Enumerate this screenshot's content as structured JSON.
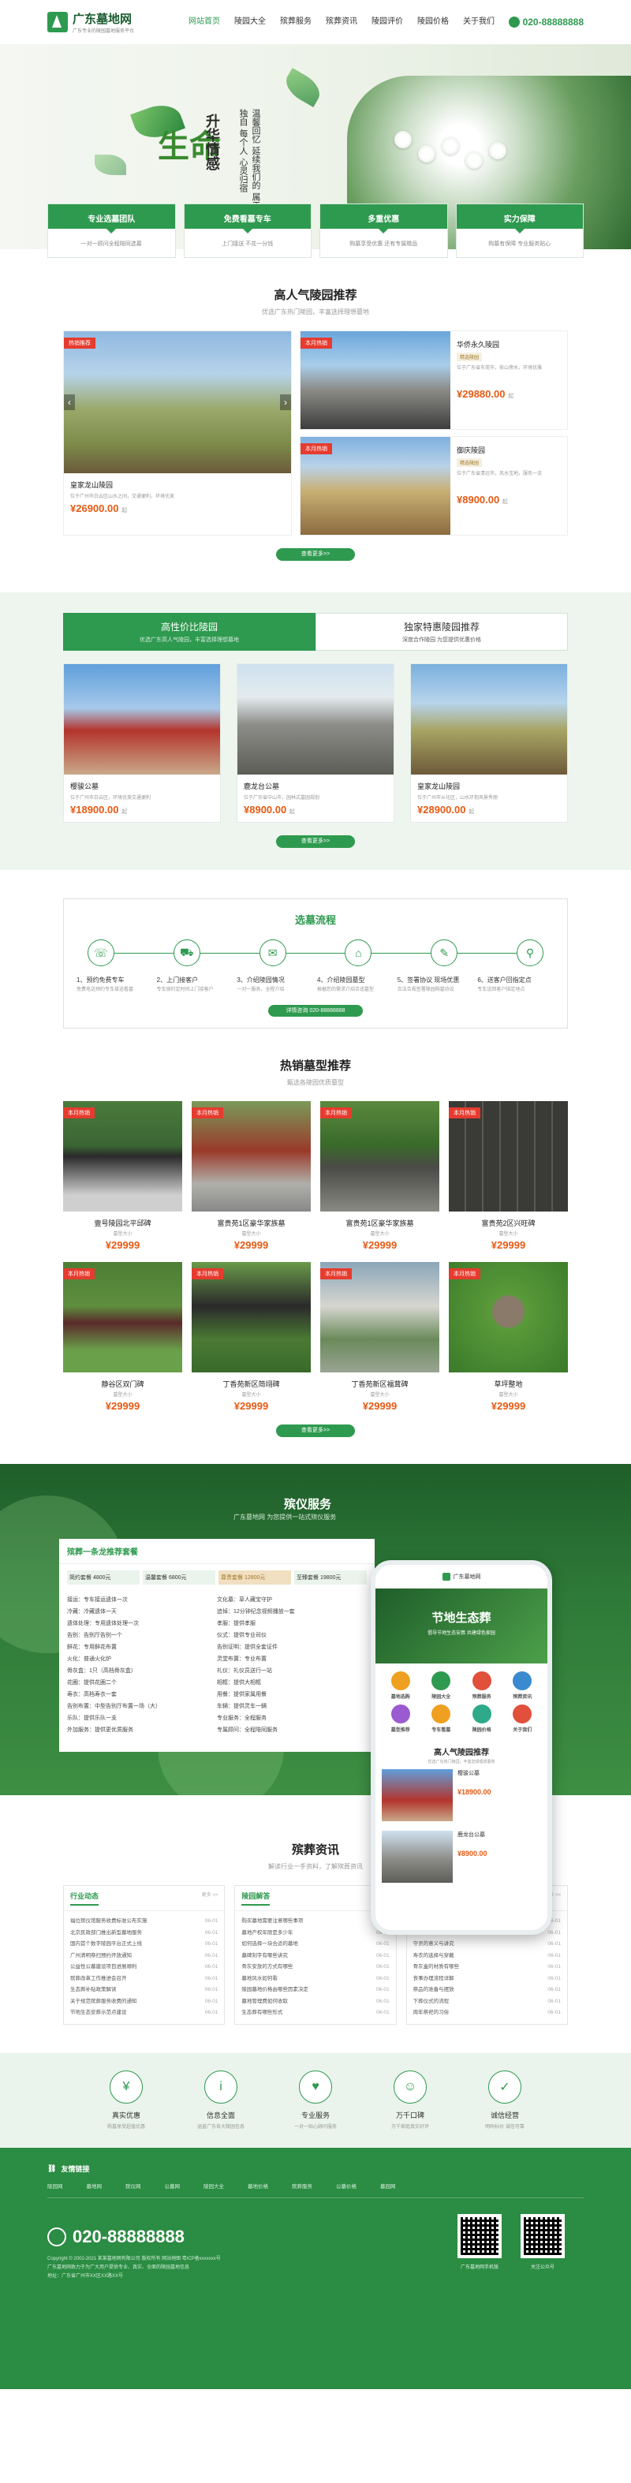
{
  "header": {
    "brand": "广东墓地网",
    "brand_sub": "广东专业的陵园墓地服务平台",
    "nav": [
      "网站首页",
      "陵园大全",
      "殡葬服务",
      "殡葬资讯",
      "陵园评价",
      "陵园价格",
      "关于我们"
    ],
    "phone": "020-88888888"
  },
  "banner": {
    "big_title": "生命",
    "vertical_1": "升华情感",
    "vertical_2": "温馨回忆 延续我们的 属于 独自 每个人 心灵归宿"
  },
  "features": [
    {
      "title": "专业选墓团队",
      "desc": "一对一顾问全程陪同选墓"
    },
    {
      "title": "免费看墓专车",
      "desc": "上门接送 不花一分钱"
    },
    {
      "title": "多重优惠",
      "desc": "购墓享受优惠 还有专属赠品"
    },
    {
      "title": "实力保障",
      "desc": "购墓有保障 专业服务贴心"
    }
  ],
  "popular": {
    "title": "高人气陵园推荐",
    "subtitle": "优选广东热门陵园，丰富选择理想墓地",
    "main": {
      "tag": "热销推荐",
      "name": "皇家龙山陵园",
      "desc": "位于广州市白云区山水之间，交通便利，环境优美",
      "price": "¥26900.00",
      "unit": "起"
    },
    "side": [
      {
        "tag": "本月热销",
        "name": "华侨永久陵园",
        "badge": "精选陵园",
        "desc": "位于广东省东莞市，依山傍水，环境优雅",
        "price": "¥29880.00",
        "unit": "起"
      },
      {
        "tag": "本月热销",
        "name": "御庆陵园",
        "badge": "精选陵园",
        "desc": "位于广东省清远市，风水宝地，服务一流",
        "price": "¥8900.00",
        "unit": "起"
      }
    ],
    "more": "查看更多>>"
  },
  "value": {
    "tabs": [
      {
        "title": "高性价比陵园",
        "sub": "优选广东高人气陵园，丰富选择理想墓地"
      },
      {
        "title": "独家特惠陵园推荐",
        "sub": "深度合作陵园 为您提供优惠价格"
      }
    ],
    "cards": [
      {
        "name": "樱骏公墓",
        "desc": "位于广州市白云区，环境优美交通便利",
        "price": "¥18900.00",
        "unit": "起"
      },
      {
        "name": "鹿龙台公墓",
        "desc": "位于广东省中山市，园林式墓园规划",
        "price": "¥8900.00",
        "unit": "起"
      },
      {
        "name": "皇家龙山陵园",
        "desc": "位于广州市从化区，山水环抱风景秀丽",
        "price": "¥28900.00",
        "unit": "起"
      }
    ],
    "more": "查看更多>>"
  },
  "process": {
    "title": "选墓流程",
    "steps": [
      {
        "title": "1、预约免费专车",
        "desc": "免费电话预约专车接送看墓"
      },
      {
        "title": "2、上门接客户",
        "desc": "专车按约定时间上门接客户"
      },
      {
        "title": "3、介绍陵园情况",
        "desc": "一对一服务，全程介绍"
      },
      {
        "title": "4、介绍陵园墓型",
        "desc": "根据您的需求介绍合适墓型"
      },
      {
        "title": "5、签署协议 现场优惠",
        "desc": "合法合规签署陵园购墓协议"
      },
      {
        "title": "6、送客户回指定点",
        "desc": "专车送回客户指定地点"
      }
    ],
    "btn": "详情咨询 020-88888888"
  },
  "hot": {
    "title": "热销墓型推荐",
    "subtitle": "甄选各陵园优质墓型",
    "items": [
      {
        "tag": "本月热销",
        "name": "壹号陵园北平邱碑",
        "sub": "墓型大小",
        "price": "¥29999"
      },
      {
        "tag": "本月热销",
        "name": "富贵苑1区豪华家族墓",
        "sub": "墓型大小",
        "price": "¥29999"
      },
      {
        "tag": "本月热销",
        "name": "富贵苑1区豪华家族墓",
        "sub": "墓型大小",
        "price": "¥29999"
      },
      {
        "tag": "本月热销",
        "name": "富贵苑2区兴旺碑",
        "sub": "墓型大小",
        "price": "¥29999"
      },
      {
        "tag": "本月热销",
        "name": "静谷区双门碑",
        "sub": "墓型大小",
        "price": "¥29999"
      },
      {
        "tag": "本月热销",
        "name": "丁香苑新区简翊碑",
        "sub": "墓型大小",
        "price": "¥29999"
      },
      {
        "tag": "本月热销",
        "name": "丁香苑新区福茸碑",
        "sub": "墓型大小",
        "price": "¥29999"
      },
      {
        "tag": "本月热销",
        "name": "草坪整地",
        "sub": "墓型大小",
        "price": "¥29999"
      }
    ],
    "more": "查看更多>>"
  },
  "service": {
    "title": "殡仪服务",
    "subtitle": "广东墓地网 为您提供一站式殡仪服务",
    "panel_title": "殡葬一条龙推荐套餐",
    "prices": [
      "简约套餐 4800元",
      "温馨套餐 6800元",
      "尊贵套餐 12800元",
      "至臻套餐 19800元"
    ],
    "col1": [
      "接运：专车接运遗体一次",
      "冷藏：冷藏遗体一天",
      "遗体处理：专用遗体处理一次",
      "告别：告别厅告别一个",
      "鲜花：专用鲜花布置",
      "火化：普通火化炉",
      "骨灰盒：1只（高档骨灰盒）",
      "花圈：提供花圈二个",
      "寿衣：高档寿衣一套",
      "告别布置：中型告别厅布置一场（大）",
      "乐队：提供乐队一支",
      "外加服务：提供更优质服务"
    ],
    "col2": [
      "文化墓：草人藏宝守护",
      "追悼：12分钟纪念视频播放一套",
      "孝服：提供孝服",
      "仪式：提供专业司仪",
      "告别证明：提供全套证件",
      "灵堂布置：专业布置",
      "礼仪：礼仪员送行一站",
      "相框：提供大相框",
      "用餐：提供家属用餐",
      "车辆：提供灵车一辆",
      "专业服务：全程服务",
      "专属顾问：全程陪同服务"
    ]
  },
  "mobile": {
    "site": "广东墓地网",
    "hero": "节地生态葬",
    "hero_sub": "倡导节地生态安葬 共建绿色家园",
    "icons": [
      "墓地选购",
      "陵园大全",
      "殡葬服务",
      "殡葬资讯",
      "墓型推荐",
      "专车看墓",
      "陵园价格",
      "关于我们"
    ],
    "sec": "高人气陵园推荐",
    "sec_sub": "优选广东热门陵园，丰富选择理想墓地",
    "items": [
      {
        "name": "樱骏公墓",
        "price": "¥18900.00"
      },
      {
        "name": "鹿龙台公墓",
        "price": "¥8900.00"
      }
    ]
  },
  "news": {
    "title": "殡葬资讯",
    "subtitle": "解读行业一手资料，了解殡葬资讯",
    "cols": [
      {
        "title": "行业动态",
        "more": "更多 >>",
        "items": [
          [
            "福位殡仪馆服务收费标准公布实施",
            "06-01"
          ],
          [
            "北京民政部门推出新型墓地服务",
            "06-01"
          ],
          [
            "国内首个数字陵园平台正式上线",
            "06-01"
          ],
          [
            "广州清明祭扫预约开放通知",
            "06-01"
          ],
          [
            "公益性公墓建设项目进展顺利",
            "06-01"
          ],
          [
            "殡葬改革工作推进会召开",
            "06-01"
          ],
          [
            "生态葬补贴政策解读",
            "06-01"
          ],
          [
            "关于规范殡葬服务收费的通知",
            "06-01"
          ],
          [
            "节地生态安葬示范点建设",
            "06-01"
          ]
        ]
      },
      {
        "title": "陵园解答",
        "more": "更多 >>",
        "items": [
          [
            "购买墓地需要注意哪些事项",
            "06-01"
          ],
          [
            "墓地产权年限是多少年",
            "06-01"
          ],
          [
            "如何选择一块合适的墓地",
            "06-01"
          ],
          [
            "墓碑刻字有哪些讲究",
            "06-01"
          ],
          [
            "骨灰安放的方式有哪些",
            "06-01"
          ],
          [
            "墓地风水如何看",
            "06-01"
          ],
          [
            "陵园墓地价格由哪些因素决定",
            "06-01"
          ],
          [
            "墓地管理费如何收取",
            "06-01"
          ],
          [
            "生态葬有哪些形式",
            "06-01"
          ]
        ]
      },
      {
        "title": "殡葬知识",
        "more": "更多 >>",
        "items": [
          [
            "传统丧葬礼仪知识介绍",
            "06-01"
          ],
          [
            "清明节祭扫的习俗",
            "06-01"
          ],
          [
            "守灵的意义与讲究",
            "06-01"
          ],
          [
            "寿衣的选择与穿戴",
            "06-01"
          ],
          [
            "骨灰盒的材质有哪些",
            "06-01"
          ],
          [
            "丧事办理流程详解",
            "06-01"
          ],
          [
            "祭品的准备与摆放",
            "06-01"
          ],
          [
            "下葬仪式的流程",
            "06-01"
          ],
          [
            "周年祭祀的习俗",
            "06-01"
          ]
        ]
      }
    ]
  },
  "advantages": [
    {
      "icon": "¥",
      "title": "真实优惠",
      "desc": "购墓享受超值优惠"
    },
    {
      "icon": "i",
      "title": "信息全面",
      "desc": "涵盖广东各大陵园信息"
    },
    {
      "icon": "♥",
      "title": "专业服务",
      "desc": "一对一贴心顾问服务"
    },
    {
      "icon": "☺",
      "title": "万千口碑",
      "desc": "万千家庭真实好评"
    },
    {
      "icon": "✓",
      "title": "诚信经营",
      "desc": "明码标价 诚信可靠"
    }
  ],
  "footer": {
    "links_title": "友情链接",
    "links": [
      "陵园网",
      "墓地网",
      "殡仪网",
      "公墓网",
      "陵园大全",
      "墓地价格",
      "殡葬服务",
      "公墓价格",
      "墓园网"
    ],
    "phone": "020-88888888",
    "lines": [
      "Copyright © 2002-2021 某某墓地网有限公司 版权所有 网站地图 粤ICP备xxxxxxx号",
      "广东墓地网致力于为广大用户提供专业、真实、全面的陵园墓地信息",
      "地址：广东省广州市XX区XX路XX号"
    ],
    "qr1": "广东墓地网手机版",
    "qr2": "关注公众号"
  }
}
